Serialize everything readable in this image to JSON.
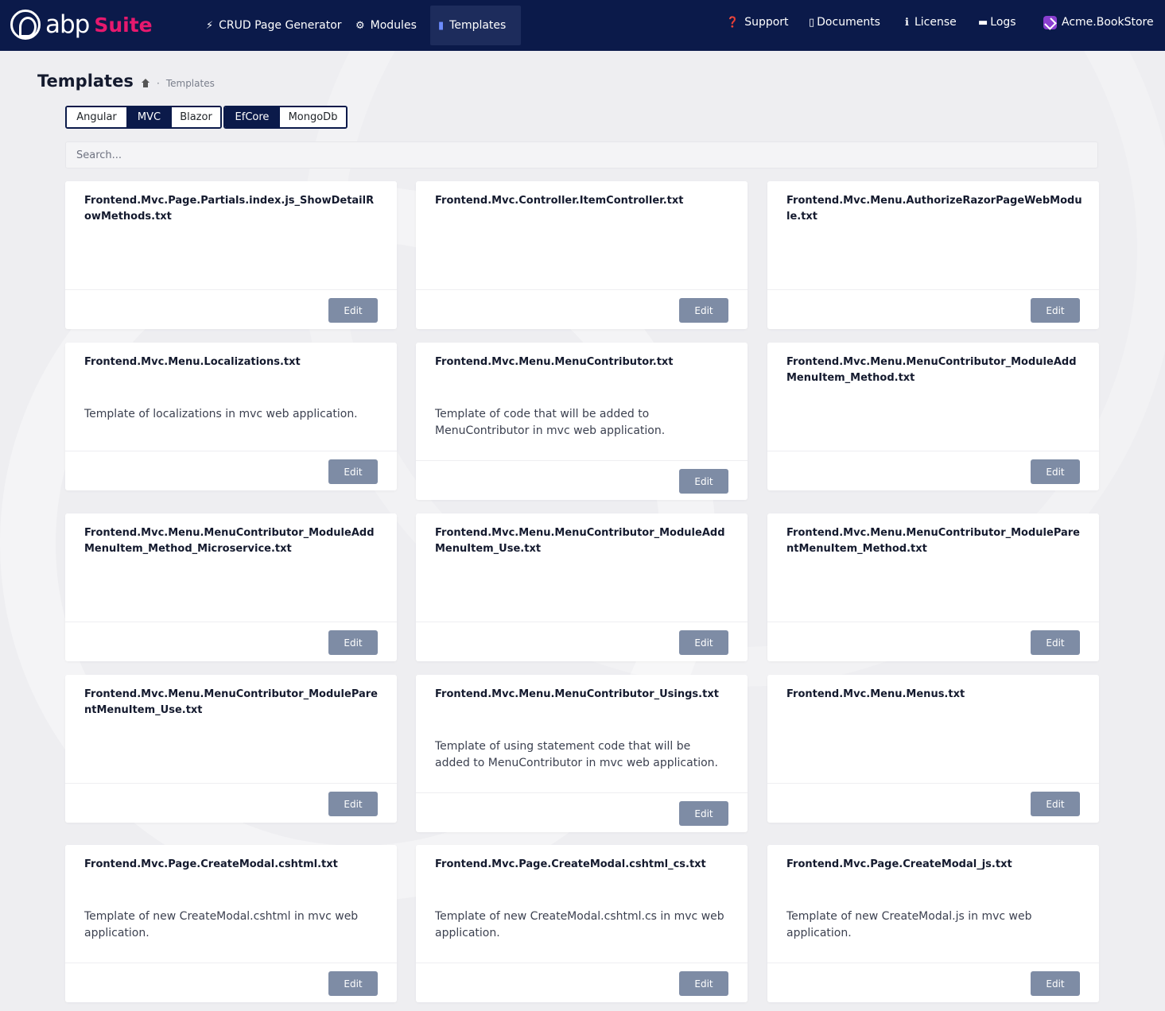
{
  "brand": {
    "abp": "abp",
    "suite": "Suite"
  },
  "nav": {
    "crud": "CRUD Page Generator",
    "modules": "Modules",
    "templates": "Templates",
    "support": "Support",
    "documents": "Documents",
    "license": "License",
    "logs": "Logs",
    "solution": "Acme.BookStore"
  },
  "header": {
    "title": "Templates",
    "breadcrumb": "Templates"
  },
  "ui_frameworks": [
    "Angular",
    "MVC",
    "Blazor"
  ],
  "ui_selected": "MVC",
  "db_providers": [
    "EfCore",
    "MongoDb"
  ],
  "db_selected": "EfCore",
  "search": {
    "placeholder": "Search..."
  },
  "edit_label": "Edit",
  "cards": [
    {
      "title": "Frontend.Mvc.Page.Partials.index.js_ShowDetailRowMethods.txt",
      "desc": ""
    },
    {
      "title": "Frontend.Mvc.Controller.ItemController.txt",
      "desc": ""
    },
    {
      "title": "Frontend.Mvc.Menu.AuthorizeRazorPageWebModule.txt",
      "desc": ""
    },
    {
      "title": "Frontend.Mvc.Menu.Localizations.txt",
      "desc": "Template of localizations in mvc web application."
    },
    {
      "title": "Frontend.Mvc.Menu.MenuContributor.txt",
      "desc": "Template of code that will be added to MenuContributor in mvc web application."
    },
    {
      "title": "Frontend.Mvc.Menu.MenuContributor_ModuleAddMenuItem_Method.txt",
      "desc": ""
    },
    {
      "title": "Frontend.Mvc.Menu.MenuContributor_ModuleAddMenuItem_Method_Microservice.txt",
      "desc": ""
    },
    {
      "title": "Frontend.Mvc.Menu.MenuContributor_ModuleAddMenuItem_Use.txt",
      "desc": ""
    },
    {
      "title": "Frontend.Mvc.Menu.MenuContributor_ModuleParentMenuItem_Method.txt",
      "desc": ""
    },
    {
      "title": "Frontend.Mvc.Menu.MenuContributor_ModuleParentMenuItem_Use.txt",
      "desc": ""
    },
    {
      "title": "Frontend.Mvc.Menu.MenuContributor_Usings.txt",
      "desc": "Template of using statement code that will be added to MenuContributor in mvc web application."
    },
    {
      "title": "Frontend.Mvc.Menu.Menus.txt",
      "desc": ""
    },
    {
      "title": "Frontend.Mvc.Page.CreateModal.cshtml.txt",
      "desc": "Template of new CreateModal.cshtml in mvc web application."
    },
    {
      "title": "Frontend.Mvc.Page.CreateModal.cshtml_cs.txt",
      "desc": "Template of new CreateModal.cshtml.cs in mvc web application."
    },
    {
      "title": "Frontend.Mvc.Page.CreateModal_js.txt",
      "desc": "Template of new CreateModal.js in mvc web application."
    }
  ]
}
